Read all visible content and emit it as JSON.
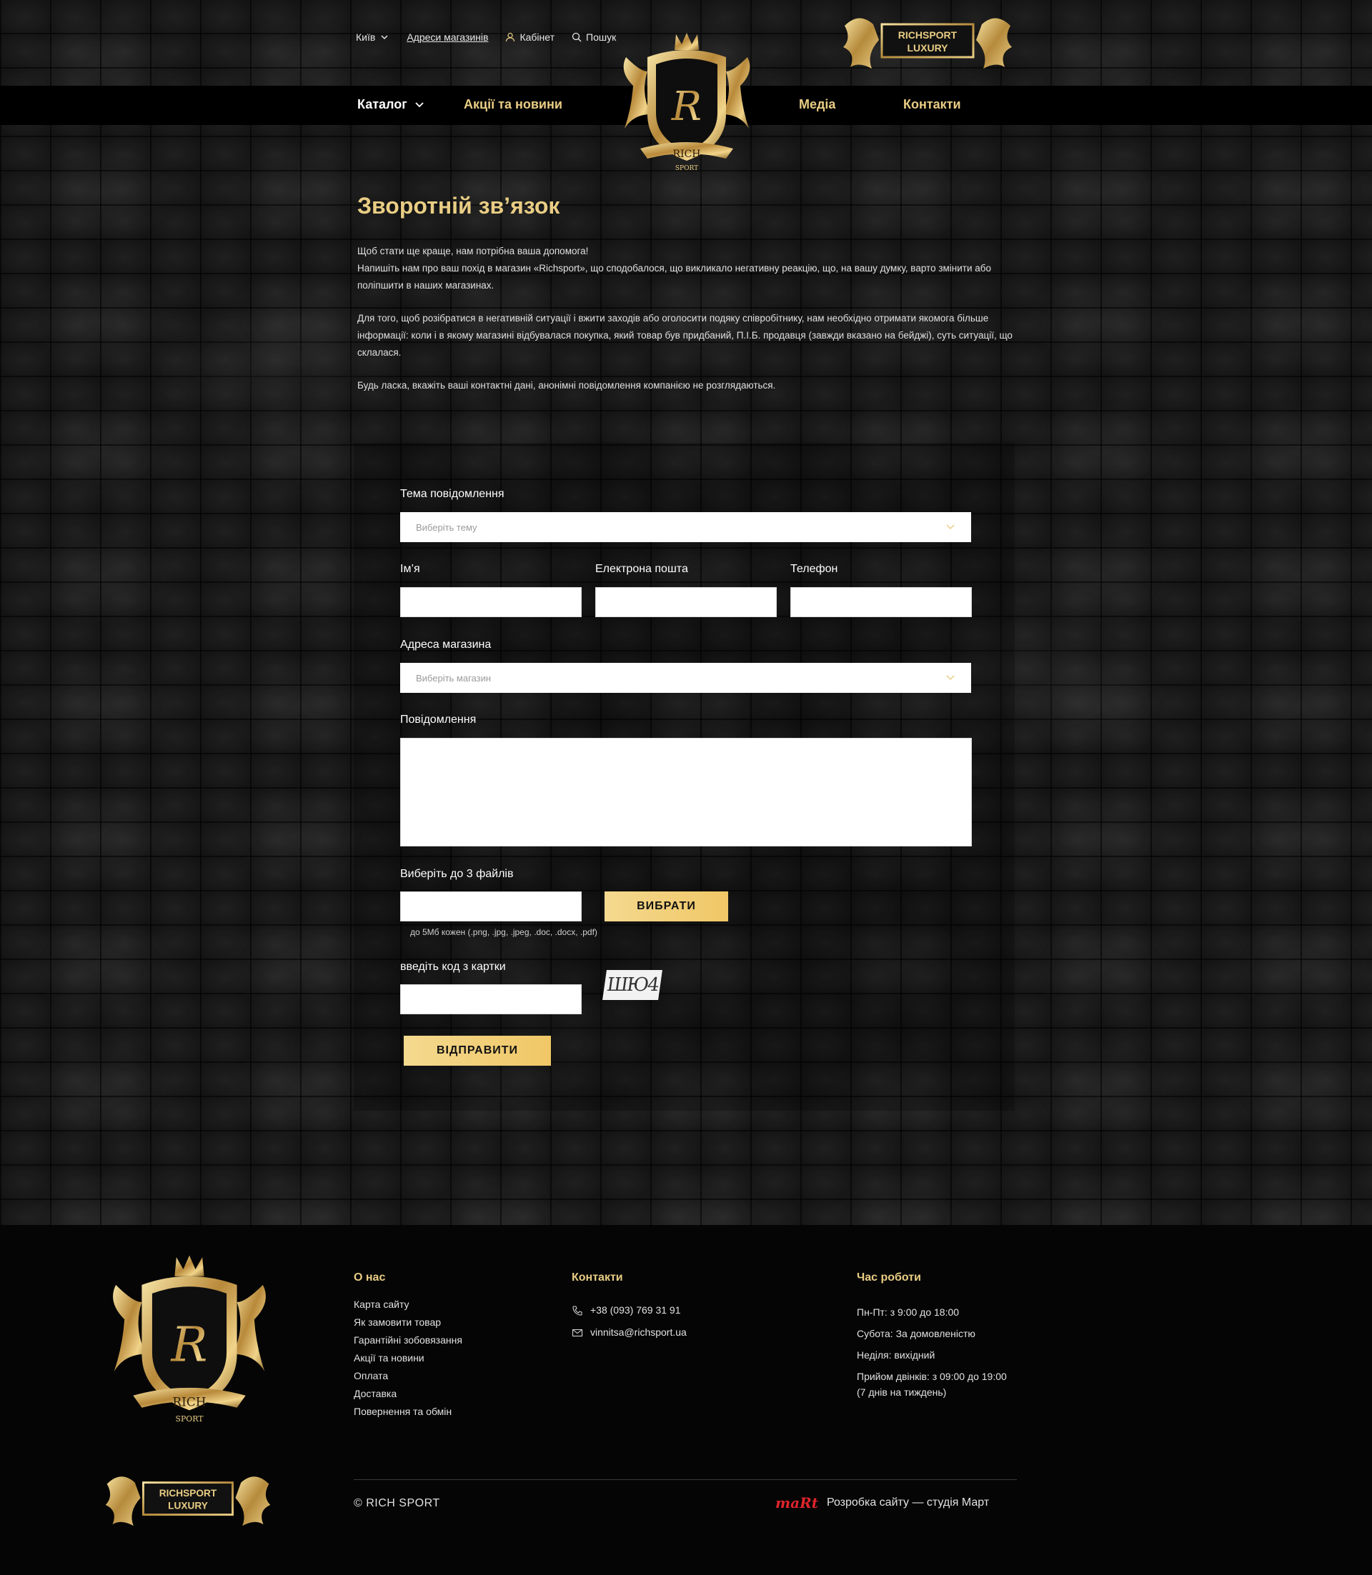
{
  "header": {
    "city": "Київ",
    "stores_link": "Адреси магазинів",
    "cabinet": "Кабінет",
    "search": "Пошук",
    "badge_line1": "RICHSPORT",
    "badge_line2": "LUXURY"
  },
  "nav": {
    "catalog": "Каталог",
    "promos": "Акції та новини",
    "media": "Медіа",
    "contacts": "Контакти"
  },
  "crest": {
    "letter": "R",
    "ribbon1": "RICH",
    "ribbon2": "SPORT"
  },
  "page": {
    "title": "Зворотній зв’язок",
    "intro_p1_l1": "Щоб стати ще краще, нам потрібна ваша допомога!",
    "intro_p1_l2": "Напишіть нам про ваш похід в магазин «Richsport», що сподобалося, що викликало негативну реакцію, що, на вашу думку, варто змінити або поліпшити в наших магазинах.",
    "intro_p2": "Для того, щоб розібратися в негативній ситуації і вжити заходів або оголосити подяку співробітнику, нам необхідно отримати якомога більше інформації: коли і в якому магазині відбувалася покупка, який товар був придбаний, П.І.Б. продавця (завжди вказано на бейджі), суть ситуації, що склалася.",
    "intro_p3": "Будь ласка, вкажіть ваші контактні дані, анонімні повідомлення компанією не розглядаються."
  },
  "form": {
    "subject_label": "Тема повідомлення",
    "subject_placeholder": "Виберіть тему",
    "name_label": "Ім’я",
    "email_label": "Електрона пошта",
    "phone_label": "Телефон",
    "store_label": "Адреса магазина",
    "store_placeholder": "Виберіть магазин",
    "message_label": "Повідомлення",
    "files_label": "Виберіть до 3 файлів",
    "choose_button": "ВИБРАТИ",
    "files_hint": "до 5Мб кожен (.png, .jpg, .jpeg, .doc, .docx, .pdf)",
    "captcha_label": "введіть код з картки",
    "captcha_code": "ШЮ4",
    "submit_button": "ВІДПРАВИТИ"
  },
  "footer": {
    "about_title": "О нас",
    "about_links": [
      "Карта сайту",
      "Як замовити товар",
      "Гарантійні зобовязання",
      "Акції та новини",
      "Оплата",
      "Доставка",
      "Повернення та обмін"
    ],
    "contacts_title": "Контакти",
    "phone": "+38 (093) 769 31 91",
    "email": "vinnitsa@richsport.ua",
    "hours_title": "Час роботи",
    "hours": [
      "Пн-Пт: з 9:00 до 18:00",
      "Субота: За домовленістю",
      "Неділя: вихідний",
      "Прийом двінків: з 09:00 до 19:00",
      "(7 днів на тиждень)"
    ],
    "copyright": "© RICH SPORT",
    "studio_logo": "maRt",
    "studio_text": "Розробка сайту — студія Март"
  },
  "colors": {
    "gold": "#e9cd84",
    "button_gold": "#f0c766",
    "studio_red": "#e0242b"
  }
}
